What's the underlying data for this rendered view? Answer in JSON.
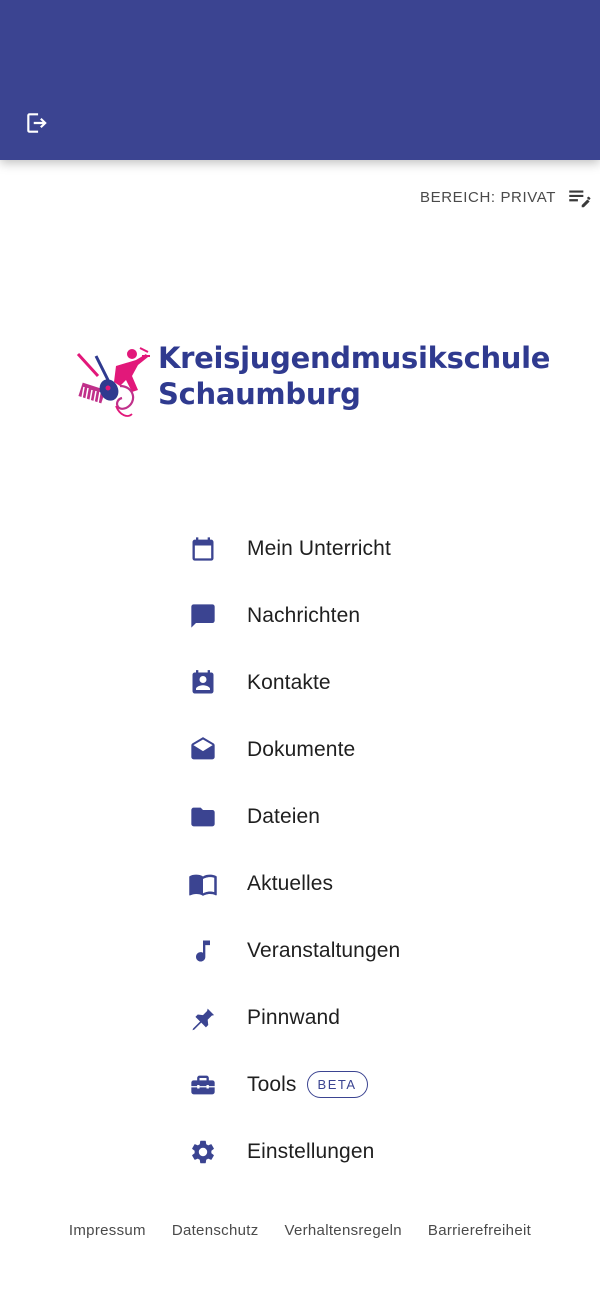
{
  "header": {
    "color": "#3b4491",
    "logout_icon": "logout-icon"
  },
  "area": {
    "label": "BEREICH: PRIVAT",
    "icon": "edit-list-icon"
  },
  "logo": {
    "line1": "Kreisjugendmusikschule",
    "line2": "Schaumburg"
  },
  "menu": {
    "items": [
      {
        "label": "Mein Unterricht",
        "icon": "calendar-icon"
      },
      {
        "label": "Nachrichten",
        "icon": "chat-icon"
      },
      {
        "label": "Kontakte",
        "icon": "contacts-icon"
      },
      {
        "label": "Dokumente",
        "icon": "drafts-icon"
      },
      {
        "label": "Dateien",
        "icon": "folder-icon"
      },
      {
        "label": "Aktuelles",
        "icon": "book-icon"
      },
      {
        "label": "Veranstaltungen",
        "icon": "music-note-icon"
      },
      {
        "label": "Pinnwand",
        "icon": "pin-icon"
      },
      {
        "label": "Tools",
        "icon": "toolbox-icon",
        "badge": "BETA"
      },
      {
        "label": "Einstellungen",
        "icon": "gear-icon"
      }
    ]
  },
  "footer": {
    "links": [
      "Impressum",
      "Datenschutz",
      "Verhaltensregeln",
      "Barrierefreiheit"
    ]
  }
}
